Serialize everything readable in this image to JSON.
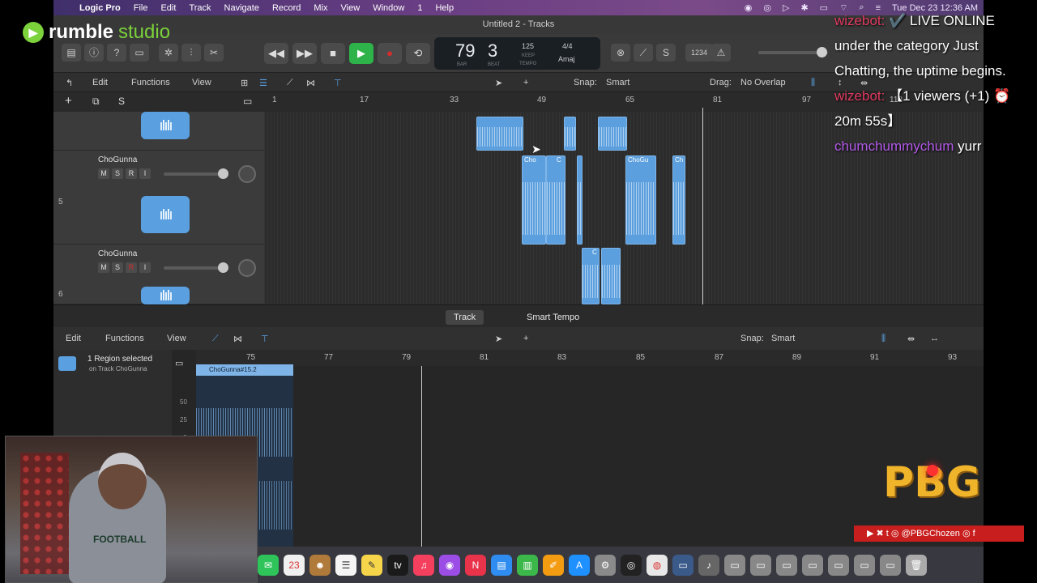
{
  "menubar": {
    "items": [
      "Logic Pro",
      "File",
      "Edit",
      "Track",
      "Navigate",
      "Record",
      "Mix",
      "View",
      "Window",
      "1",
      "Help"
    ],
    "clock": "Tue Dec 23  12:36 AM"
  },
  "window": {
    "title": "Untitled 2 - Tracks"
  },
  "lcd": {
    "bar": "79",
    "beat": "3",
    "bar_label": "BAR",
    "beat_label": "BEAT",
    "tempo": "125",
    "tempo_mode": "KEEP",
    "tempo_label": "TEMPO",
    "signature": "4/4",
    "key": "Amaj"
  },
  "toolbar": {
    "counter": "1234"
  },
  "tracks_header": {
    "edit": "Edit",
    "functions": "Functions",
    "view": "View",
    "snap_label": "Snap:",
    "snap_value": "Smart",
    "drag_label": "Drag:",
    "drag_value": "No Overlap",
    "solo": "S"
  },
  "ruler": [
    "1",
    "17",
    "33",
    "49",
    "65",
    "81",
    "97",
    "113"
  ],
  "tracks": [
    {
      "number": "5",
      "name": "ChoGunna",
      "m": "M",
      "s": "S",
      "r": "R",
      "i": "I"
    },
    {
      "number": "6",
      "name": "ChoGunna",
      "m": "M",
      "s": "S",
      "r": "R",
      "i": "I"
    }
  ],
  "regions": {
    "labels": [
      "Cho",
      "C",
      "ChoGu",
      "Ch",
      "C"
    ]
  },
  "editor": {
    "tab_track": "Track",
    "tab_smart_tempo": "Smart Tempo",
    "edit": "Edit",
    "functions": "Functions",
    "view": "View",
    "snap_label": "Snap:",
    "snap_value": "Smart",
    "selection_title": "1 Region selected",
    "selection_sub": "on Track ChoGunna",
    "region_name": "ChoGunna#15.2",
    "ruler": [
      "75",
      "77",
      "79",
      "81",
      "83",
      "85",
      "87",
      "89",
      "91",
      "93"
    ],
    "levels": [
      "50",
      "25",
      "0"
    ]
  },
  "overlay": {
    "brand": "rumble",
    "brand_suffix": "studio",
    "chat": [
      {
        "user": "wizebot:",
        "text": "✔️ LIVE ONLINE under the category Just Chatting, the uptime begins."
      },
      {
        "user": "wizebot:",
        "text": "【1 viewers (+1) ⏰ 20m 55s】"
      },
      {
        "user": "chumchummychum",
        "text": "yurr"
      }
    ],
    "logo_text": "PBG",
    "social_handle": "@PBGChozen",
    "webcam_shirt": "FOOTBALL"
  },
  "colors": {
    "region": "#5b9fde",
    "play": "#2eb34a",
    "record": "#d62b2b",
    "chat_user1": "#e23b61",
    "chat_user2": "#b259e8",
    "brand": "#7bd23a",
    "pbg": "#f0b42a"
  }
}
